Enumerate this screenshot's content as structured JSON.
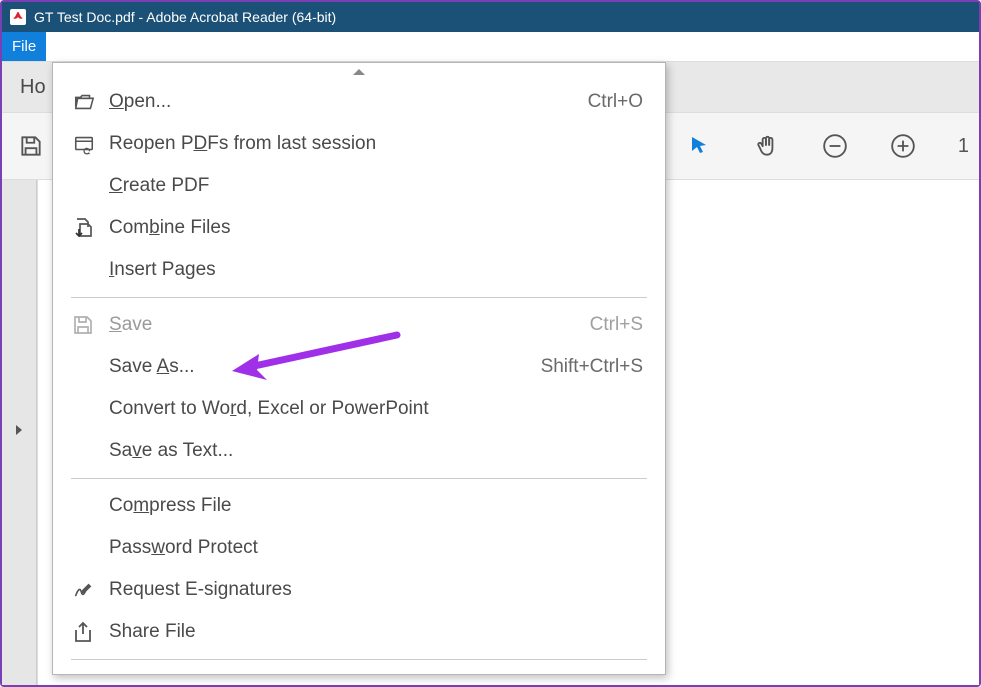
{
  "window": {
    "title": "GT Test Doc.pdf - Adobe Acrobat Reader (64-bit)"
  },
  "menubar": {
    "file": "File"
  },
  "tabbar": {
    "home_partial": "Ho"
  },
  "toolbar": {
    "zoom_partial": "1"
  },
  "file_menu": {
    "open": {
      "label": "Open...",
      "u_idx": 0,
      "shortcut": "Ctrl+O"
    },
    "reopen": {
      "pre": "Reopen P",
      "u": "D",
      "post": "Fs from last session"
    },
    "create_pdf": {
      "u": "C",
      "post": "reate PDF"
    },
    "combine": {
      "pre": "Com",
      "u": "b",
      "post": "ine Files"
    },
    "insert_pages": {
      "u": "I",
      "post": "nsert Pages"
    },
    "save": {
      "u": "S",
      "post": "ave",
      "shortcut": "Ctrl+S"
    },
    "save_as": {
      "pre": "Save ",
      "u": "A",
      "post": "s...",
      "shortcut": "Shift+Ctrl+S"
    },
    "convert": {
      "pre": "Convert to Wo",
      "u": "r",
      "post": "d, Excel or PowerPoint"
    },
    "save_text": {
      "pre": "Sa",
      "u": "v",
      "post": "e as Text..."
    },
    "compress": {
      "pre": "Co",
      "u": "m",
      "post": "press File"
    },
    "password": {
      "pre": "Pass",
      "u": "w",
      "post": "ord Protect"
    },
    "esign": {
      "label": "Request E-signatures"
    },
    "share": {
      "label": "Share File"
    }
  }
}
